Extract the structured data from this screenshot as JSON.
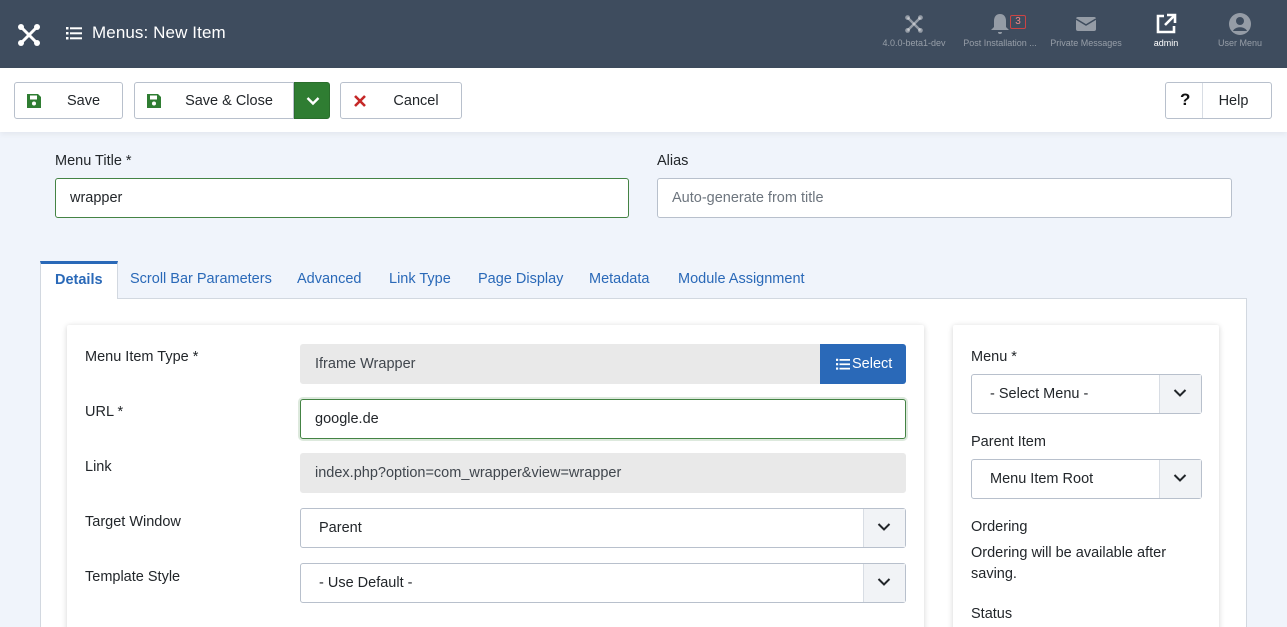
{
  "header": {
    "title": "Menus: New Item",
    "items": [
      {
        "label": "4.0.0-beta1-dev",
        "icon": "joomla-icon"
      },
      {
        "label": "Post Installation ...",
        "icon": "bell-icon",
        "badge": "3"
      },
      {
        "label": "Private Messages",
        "icon": "envelope-icon"
      },
      {
        "label": "admin",
        "icon": "external-link-icon"
      },
      {
        "label": "User Menu",
        "icon": "user-icon"
      }
    ]
  },
  "toolbar": {
    "save_label": "Save",
    "save_close_label": "Save & Close",
    "cancel_label": "Cancel",
    "help_label": "Help"
  },
  "form": {
    "menu_title_label": "Menu Title *",
    "menu_title_value": "wrapper",
    "alias_label": "Alias",
    "alias_placeholder": "Auto-generate from title"
  },
  "tabs": [
    "Details",
    "Scroll Bar Parameters",
    "Advanced",
    "Link Type",
    "Page Display",
    "Metadata",
    "Module Assignment"
  ],
  "details": {
    "menu_item_type_label": "Menu Item Type *",
    "menu_item_type_value": "Iframe Wrapper",
    "select_button": "Select",
    "url_label": "URL *",
    "url_value": "google.de",
    "link_label": "Link",
    "link_value": "index.php?option=com_wrapper&view=wrapper",
    "target_window_label": "Target Window",
    "target_window_value": "Parent",
    "template_style_label": "Template Style",
    "template_style_value": "- Use Default -"
  },
  "sidebar": {
    "menu_label": "Menu *",
    "menu_value": "- Select Menu -",
    "parent_item_label": "Parent Item",
    "parent_item_value": "Menu Item Root",
    "ordering_label": "Ordering",
    "ordering_text": "Ordering will be available after saving.",
    "status_label": "Status"
  },
  "colors": {
    "header_bg": "#3e4c5e",
    "accent_blue": "#2a69b8",
    "save_green": "#2f7d32",
    "cancel_red": "#c52827"
  }
}
